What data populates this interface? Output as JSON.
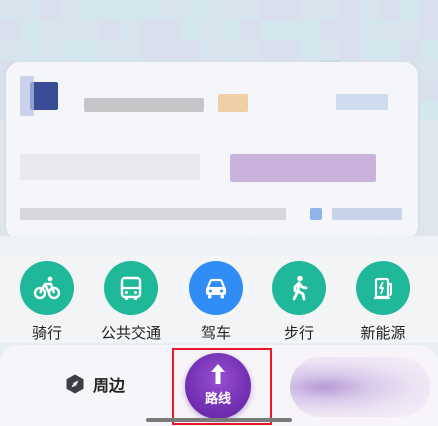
{
  "modes": [
    {
      "label": "骑行",
      "icon": "bicycle-icon",
      "color": "#1fb899"
    },
    {
      "label": "公共交通",
      "icon": "bus-icon",
      "color": "#1fb899"
    },
    {
      "label": "驾车",
      "icon": "car-icon",
      "color": "#2f8df5"
    },
    {
      "label": "步行",
      "icon": "walk-icon",
      "color": "#1fb899"
    },
    {
      "label": "新能源",
      "icon": "ev-charger-icon",
      "color": "#1fb899"
    }
  ],
  "tabbar": {
    "nearby_label": "周边",
    "nearby_icon": "hexagon-compass-icon",
    "route_label": "路线",
    "route_icon": "up-arrow-icon",
    "route_color": "#7a36b8",
    "highlight_color": "#e8182a"
  }
}
